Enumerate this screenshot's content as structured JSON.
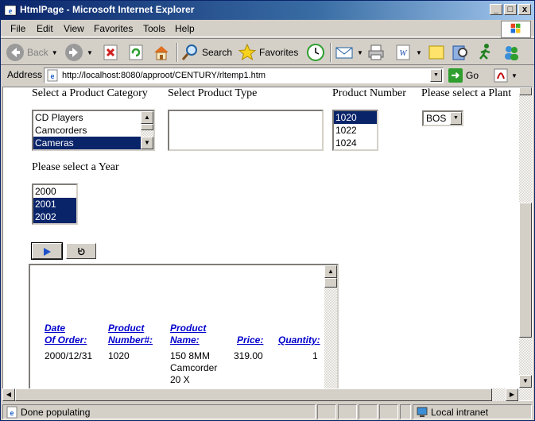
{
  "window": {
    "title": "HtmlPage - Microsoft Internet Explorer",
    "min": "_",
    "max": "□",
    "close": "x"
  },
  "menu": [
    "File",
    "Edit",
    "View",
    "Favorites",
    "Tools",
    "Help"
  ],
  "toolbar": {
    "back": "Back",
    "search": "Search",
    "favorites": "Favorites"
  },
  "address": {
    "label": "Address",
    "url": "http://localhost:8080/approot/CENTURY/rltemp1.htm",
    "go": "Go"
  },
  "form": {
    "category": {
      "label": "Select a Product Category",
      "options": [
        "CD Players",
        "Camcorders",
        "Cameras"
      ],
      "selected": "Cameras"
    },
    "type": {
      "label": "Select Product Type",
      "options": []
    },
    "number": {
      "label": "Product Number",
      "options": [
        "1020",
        "1022",
        "1024"
      ],
      "selected": "1020"
    },
    "plant": {
      "label": "Please select a Plant",
      "value": "BOS"
    },
    "year": {
      "label": "Please select a Year",
      "options": [
        "2000",
        "2001",
        "2002"
      ],
      "selected": [
        "2001",
        "2002"
      ]
    },
    "run_icon": "play-icon",
    "reset_icon": "reset-icon"
  },
  "report": {
    "headers": {
      "date_1": "Date",
      "date_2": "Of Order:",
      "number_1": "Product",
      "number_2": "Number#:",
      "name_1": "Product",
      "name_2": "Name:",
      "price": "Price:",
      "quantity": "Quantity:"
    },
    "row": {
      "date": "2000/12/31",
      "number": "1020",
      "name_1": "150 8MM",
      "name_2": "Camcorder",
      "name_3": "20 X",
      "price": "319.00",
      "quantity": "1"
    }
  },
  "status": {
    "text": "Done populating",
    "zone": "Local intranet"
  }
}
